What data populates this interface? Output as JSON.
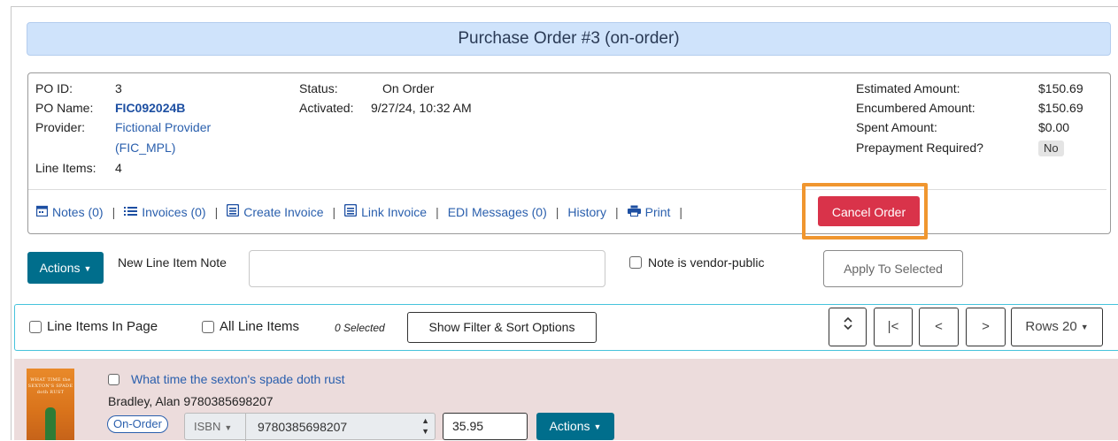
{
  "page": {
    "title": "Purchase Order #3 (on-order)"
  },
  "po": {
    "id_label": "PO ID:",
    "id_value": "3",
    "name_label": "PO Name:",
    "name_value": "FIC092024B",
    "provider_label": "Provider:",
    "provider_name": "Fictional Provider",
    "provider_code": "(FIC_MPL)",
    "line_items_label": "Line Items:",
    "line_items_value": "4",
    "status_label": "Status:",
    "status_value": "On Order",
    "activated_label": "Activated:",
    "activated_value": "9/27/24, 10:32 AM",
    "estimated_label": "Estimated Amount:",
    "estimated_value": "$150.69",
    "encumbered_label": "Encumbered Amount:",
    "encumbered_value": "$150.69",
    "spent_label": "Spent Amount:",
    "spent_value": "$0.00",
    "prepay_label": "Prepayment Required?",
    "prepay_value": "No"
  },
  "links": {
    "notes": "Notes (0)",
    "invoices": "Invoices (0)",
    "create_invoice": "Create Invoice",
    "link_invoice": "Link Invoice",
    "edi_messages": "EDI Messages (0)",
    "history": "History",
    "print": "Print",
    "separator": "|",
    "cancel_order": "Cancel Order"
  },
  "toolbar": {
    "actions_label": "Actions",
    "new_note_label": "New Line Item Note",
    "new_note_value": "",
    "vendor_public_label": "Note is vendor-public",
    "apply_label": "Apply To Selected"
  },
  "filter": {
    "line_items_in_page": "Line Items In Page",
    "all_line_items": "All Line Items",
    "selected_count": "0 Selected",
    "show_filter_label": "Show Filter & Sort Options",
    "first_page": "|<",
    "prev_page": "<",
    "next_page": ">",
    "rows_label": "Rows 20"
  },
  "line_item": {
    "title": "What time the sexton's spade doth rust",
    "author_isbn": "Bradley, Alan 9780385698207",
    "state": "On-Order",
    "ident_type": "ISBN",
    "ident_value": "9780385698207",
    "price": "35.95",
    "actions_label": "Actions",
    "cover_text": "WHAT TIME the SEXTON'S SPADE doth RUST"
  },
  "colors": {
    "title_bar": "#cfe3fb",
    "cancel_button": "#d9334a",
    "highlight": "#f0962f",
    "actions_button": "#006e8c",
    "filter_border": "#46c3dc",
    "line_item_bg": "#ecdcdc",
    "link": "#2a5fad"
  },
  "icons": {
    "notes": "calendar-icon",
    "invoices": "list-icon",
    "create_invoice": "invoice-icon",
    "link_invoice": "invoice-icon",
    "print": "printer-icon",
    "sort": "sort-updown-icon",
    "dropdown": "caret-down-icon"
  }
}
